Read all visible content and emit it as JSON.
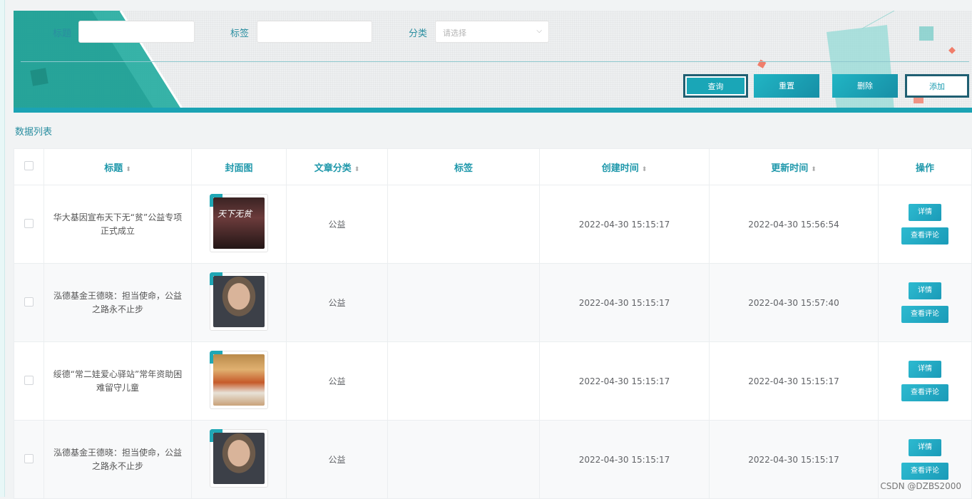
{
  "search": {
    "title_label": "标题",
    "title_value": "",
    "tag_label": "标签",
    "tag_value": "",
    "category_label": "分类",
    "category_placeholder": "请选择"
  },
  "actions": {
    "query": "查询",
    "reset": "重置",
    "delete": "删除",
    "add": "添加"
  },
  "section_title": "数据列表",
  "table": {
    "headers": {
      "title": "标题",
      "cover": "封面图",
      "category": "文章分类",
      "tags": "标签",
      "created": "创建时间",
      "updated": "更新时间",
      "ops": "操作"
    },
    "sort_glyph": "⬍",
    "rows": [
      {
        "title": "华大基因宣布天下无“贫”公益专项正式成立",
        "cover": "group-photo-dark",
        "category": "公益",
        "tags": "",
        "created": "2022-04-30 15:15:17",
        "updated": "2022-04-30 15:56:54"
      },
      {
        "title": "泓德基金王德晓：担当使命，公益之路永不止步",
        "cover": "portrait",
        "category": "公益",
        "tags": "",
        "created": "2022-04-30 15:15:17",
        "updated": "2022-04-30 15:57:40"
      },
      {
        "title": "绥德“常二娃爱心驿站”常年资助困难留守儿童",
        "cover": "group-photo-children",
        "category": "公益",
        "tags": "",
        "created": "2022-04-30 15:15:17",
        "updated": "2022-04-30 15:15:17"
      },
      {
        "title": "泓德基金王德晓：担当使命，公益之路永不止步",
        "cover": "portrait",
        "category": "公益",
        "tags": "",
        "created": "2022-04-30 15:15:17",
        "updated": "2022-04-30 15:15:17"
      }
    ],
    "row_actions": {
      "detail": "详情",
      "comments": "查看评论"
    }
  },
  "cover_overlay_text": "天下无贫",
  "watermark": "CSDN @DZBS2000",
  "colors": {
    "accent": "#1ba3b4",
    "header_text": "#1f98ab"
  }
}
